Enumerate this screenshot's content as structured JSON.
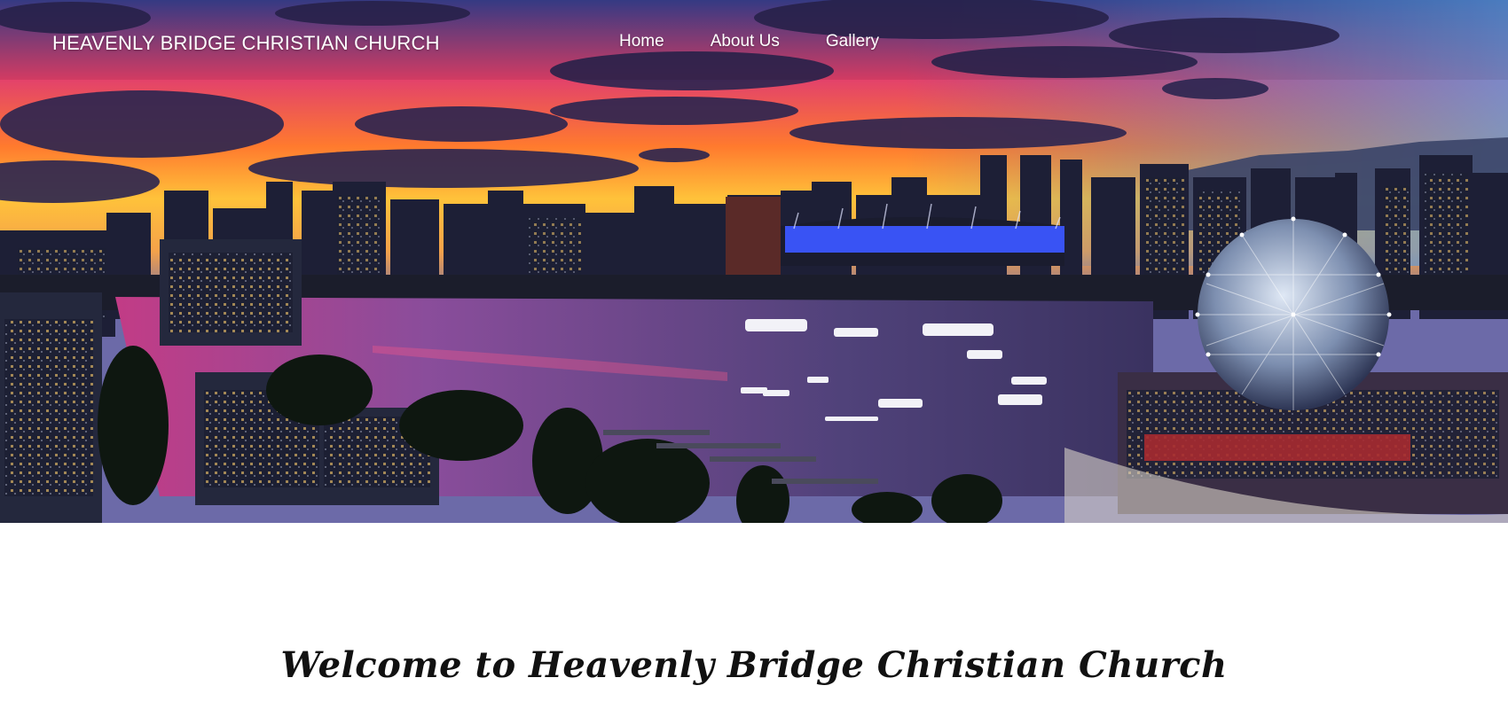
{
  "header": {
    "site_title": "HEAVENLY BRIDGE CHRISTIAN CHURCH",
    "nav": [
      {
        "label": "Home"
      },
      {
        "label": "About Us"
      },
      {
        "label": "Gallery"
      }
    ]
  },
  "hero": {
    "image": "vancouver-skyline-sunset-image"
  },
  "main": {
    "welcome_heading": "Welcome to Heavenly Bridge Christian Church"
  },
  "colors": {
    "nav_text": "#ffffff",
    "heading_text": "#111111",
    "page_background": "#ffffff"
  }
}
